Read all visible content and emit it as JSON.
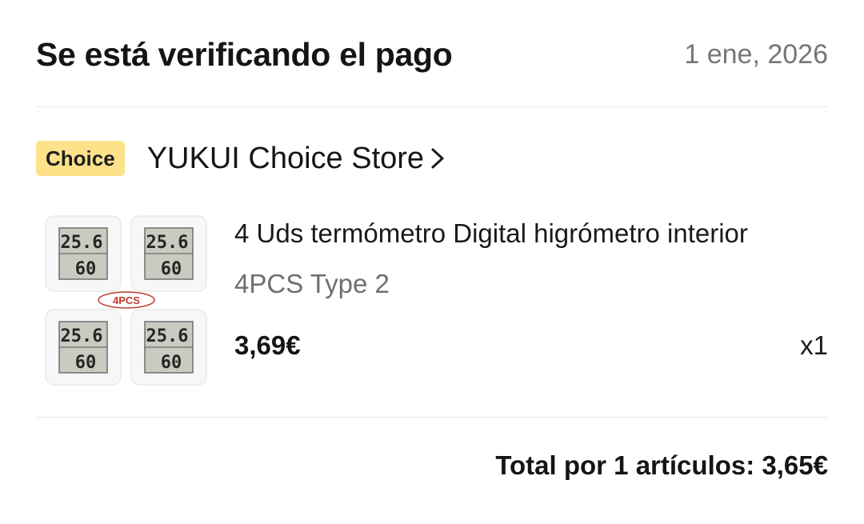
{
  "header": {
    "status_title": "Se está verificando el pago",
    "date": "1 ene, 2026"
  },
  "store": {
    "badge": "Choice",
    "name": "YUKUI Choice Store",
    "chevron_icon": "chevron-right-icon"
  },
  "product": {
    "title": "4 Uds termómetro Digital higrómetro interior",
    "variant": "4PCS Type 2",
    "price": "3,69€",
    "quantity": "x1",
    "image": {
      "pack_label": "4PCS",
      "temp_reading": "25.6",
      "humidity_reading": "60"
    }
  },
  "summary": {
    "total": "Total por 1 artículos: 3,65€"
  },
  "colors": {
    "badge_bg": "#fde28a",
    "muted_text": "#767676",
    "divider": "#e6e6e6"
  }
}
